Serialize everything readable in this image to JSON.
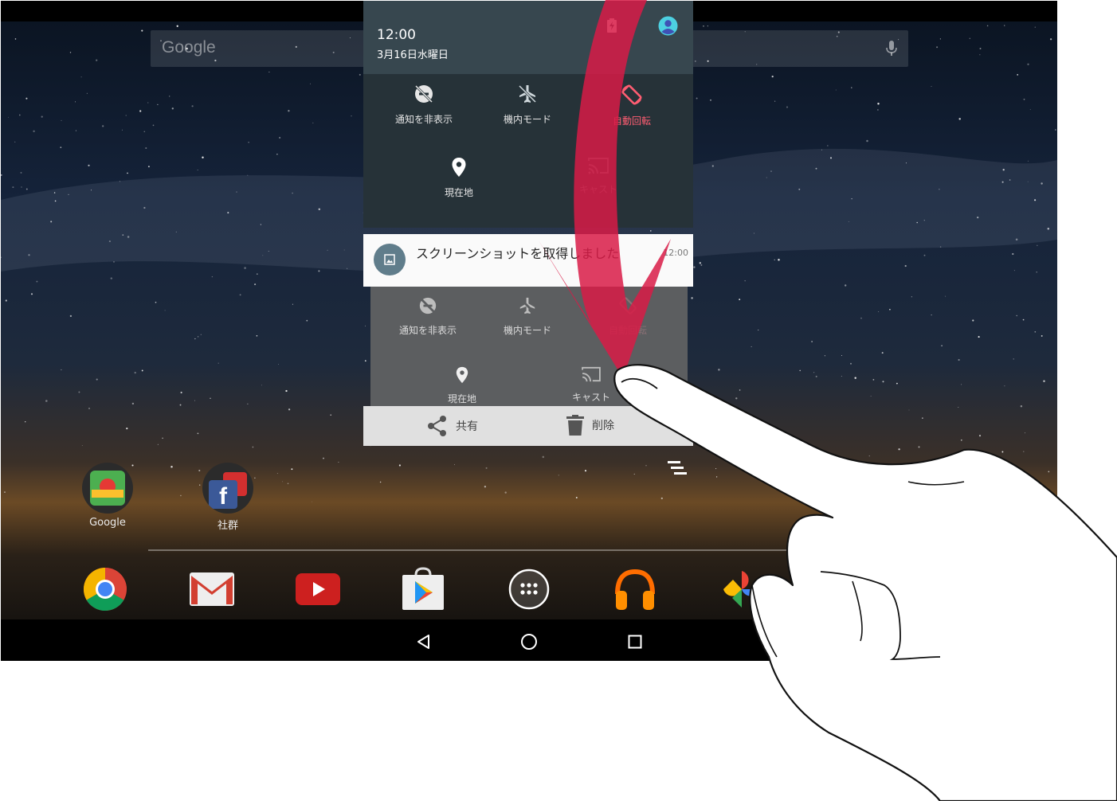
{
  "search": {
    "label": "Google"
  },
  "shade": {
    "time": "12:00",
    "date": "3月16日水曜日",
    "tiles": [
      {
        "label": "通知を非表示",
        "icon": "do-not-disturb-icon"
      },
      {
        "label": "機内モード",
        "icon": "airplane-mode-icon"
      },
      {
        "label": "自動回転",
        "icon": "auto-rotate-icon"
      },
      {
        "label": "現在地",
        "icon": "location-icon"
      },
      {
        "label": "キャスト",
        "icon": "cast-icon"
      }
    ]
  },
  "notification": {
    "title": "スクリーンショットを取得しました",
    "time": "12:00",
    "preview_tiles": [
      {
        "label": "通知を非表示"
      },
      {
        "label": "機内モード"
      },
      {
        "label": "自動回転"
      },
      {
        "label": "現在地"
      },
      {
        "label": "キャスト"
      }
    ],
    "actions": {
      "share": "共有",
      "delete": "削除"
    }
  },
  "home": {
    "apps": [
      {
        "label": "Google",
        "icon": "google-maps-icon"
      },
      {
        "label": "社群",
        "icon": "facebook-icon"
      }
    ],
    "dock": [
      "chrome-icon",
      "gmail-icon",
      "youtube-icon",
      "play-store-icon",
      "app-drawer-icon",
      "play-music-icon",
      "photos-icon"
    ]
  },
  "colors": {
    "accent": "#ff5d72",
    "arrow": "#d81b47",
    "shade_bg": "#263238",
    "shade_head": "#37474f"
  }
}
